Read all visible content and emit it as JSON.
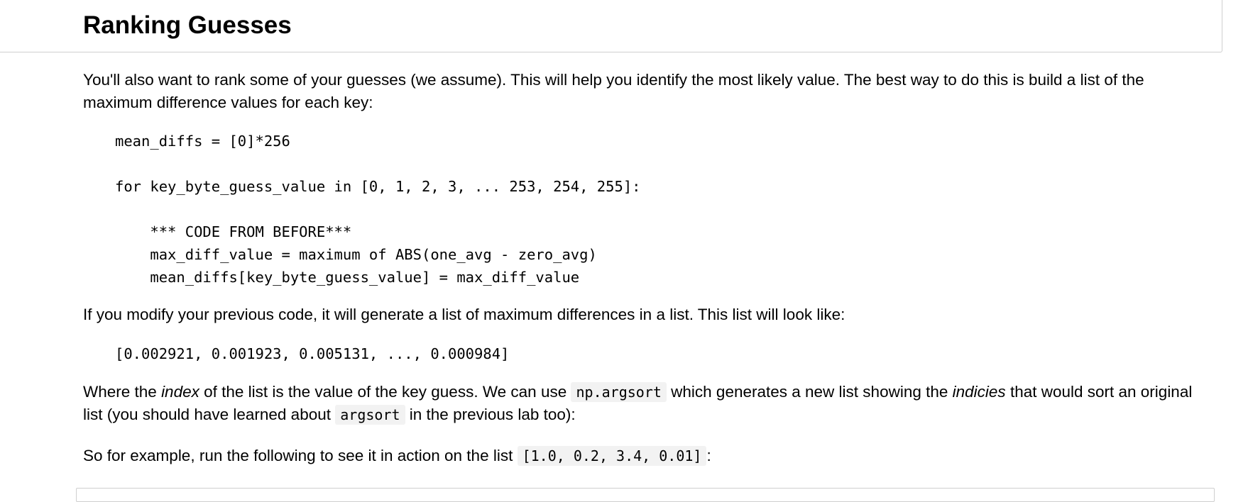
{
  "section": {
    "title": "Ranking Guesses"
  },
  "paragraphs": {
    "intro_line1": "You'll also want to rank some of your guesses (we assume). This will help you identify the most likely value. The best way to do this is build a list of the",
    "intro_line2": "maximum difference values for each key:",
    "modify": "If you modify your previous code, it will generate a list of maximum differences in a list. This list will look like:",
    "where_a": "Where the ",
    "where_index": "index",
    "where_b": " of the list is the value of the key guess. We can use ",
    "where_code": "np.argsort",
    "where_c": " which generates a new list showing the ",
    "where_indicies": "indicies",
    "where_d": " that would sort an original",
    "where_line2_a": "list (you should have learned about ",
    "where_line2_code": "argsort",
    "where_line2_b": " in the previous lab too):",
    "example_a": "So for example, run the following to see it in action on the list ",
    "example_code": "[1.0, 0.2, 3.4, 0.01]",
    "example_b": ":"
  },
  "code_blocks": {
    "pseudocode": [
      "mean_diffs = [0]*256",
      "",
      "for key_byte_guess_value in [0, 1, 2, 3, ... 253, 254, 255]:",
      "",
      "    *** CODE FROM BEFORE***",
      "    max_diff_value = maximum of ABS(one_avg - zero_avg)",
      "    mean_diffs[key_byte_guess_value] = max_diff_value"
    ],
    "list_example": "[0.002921, 0.001923, 0.005131, ..., 0.000984]"
  }
}
